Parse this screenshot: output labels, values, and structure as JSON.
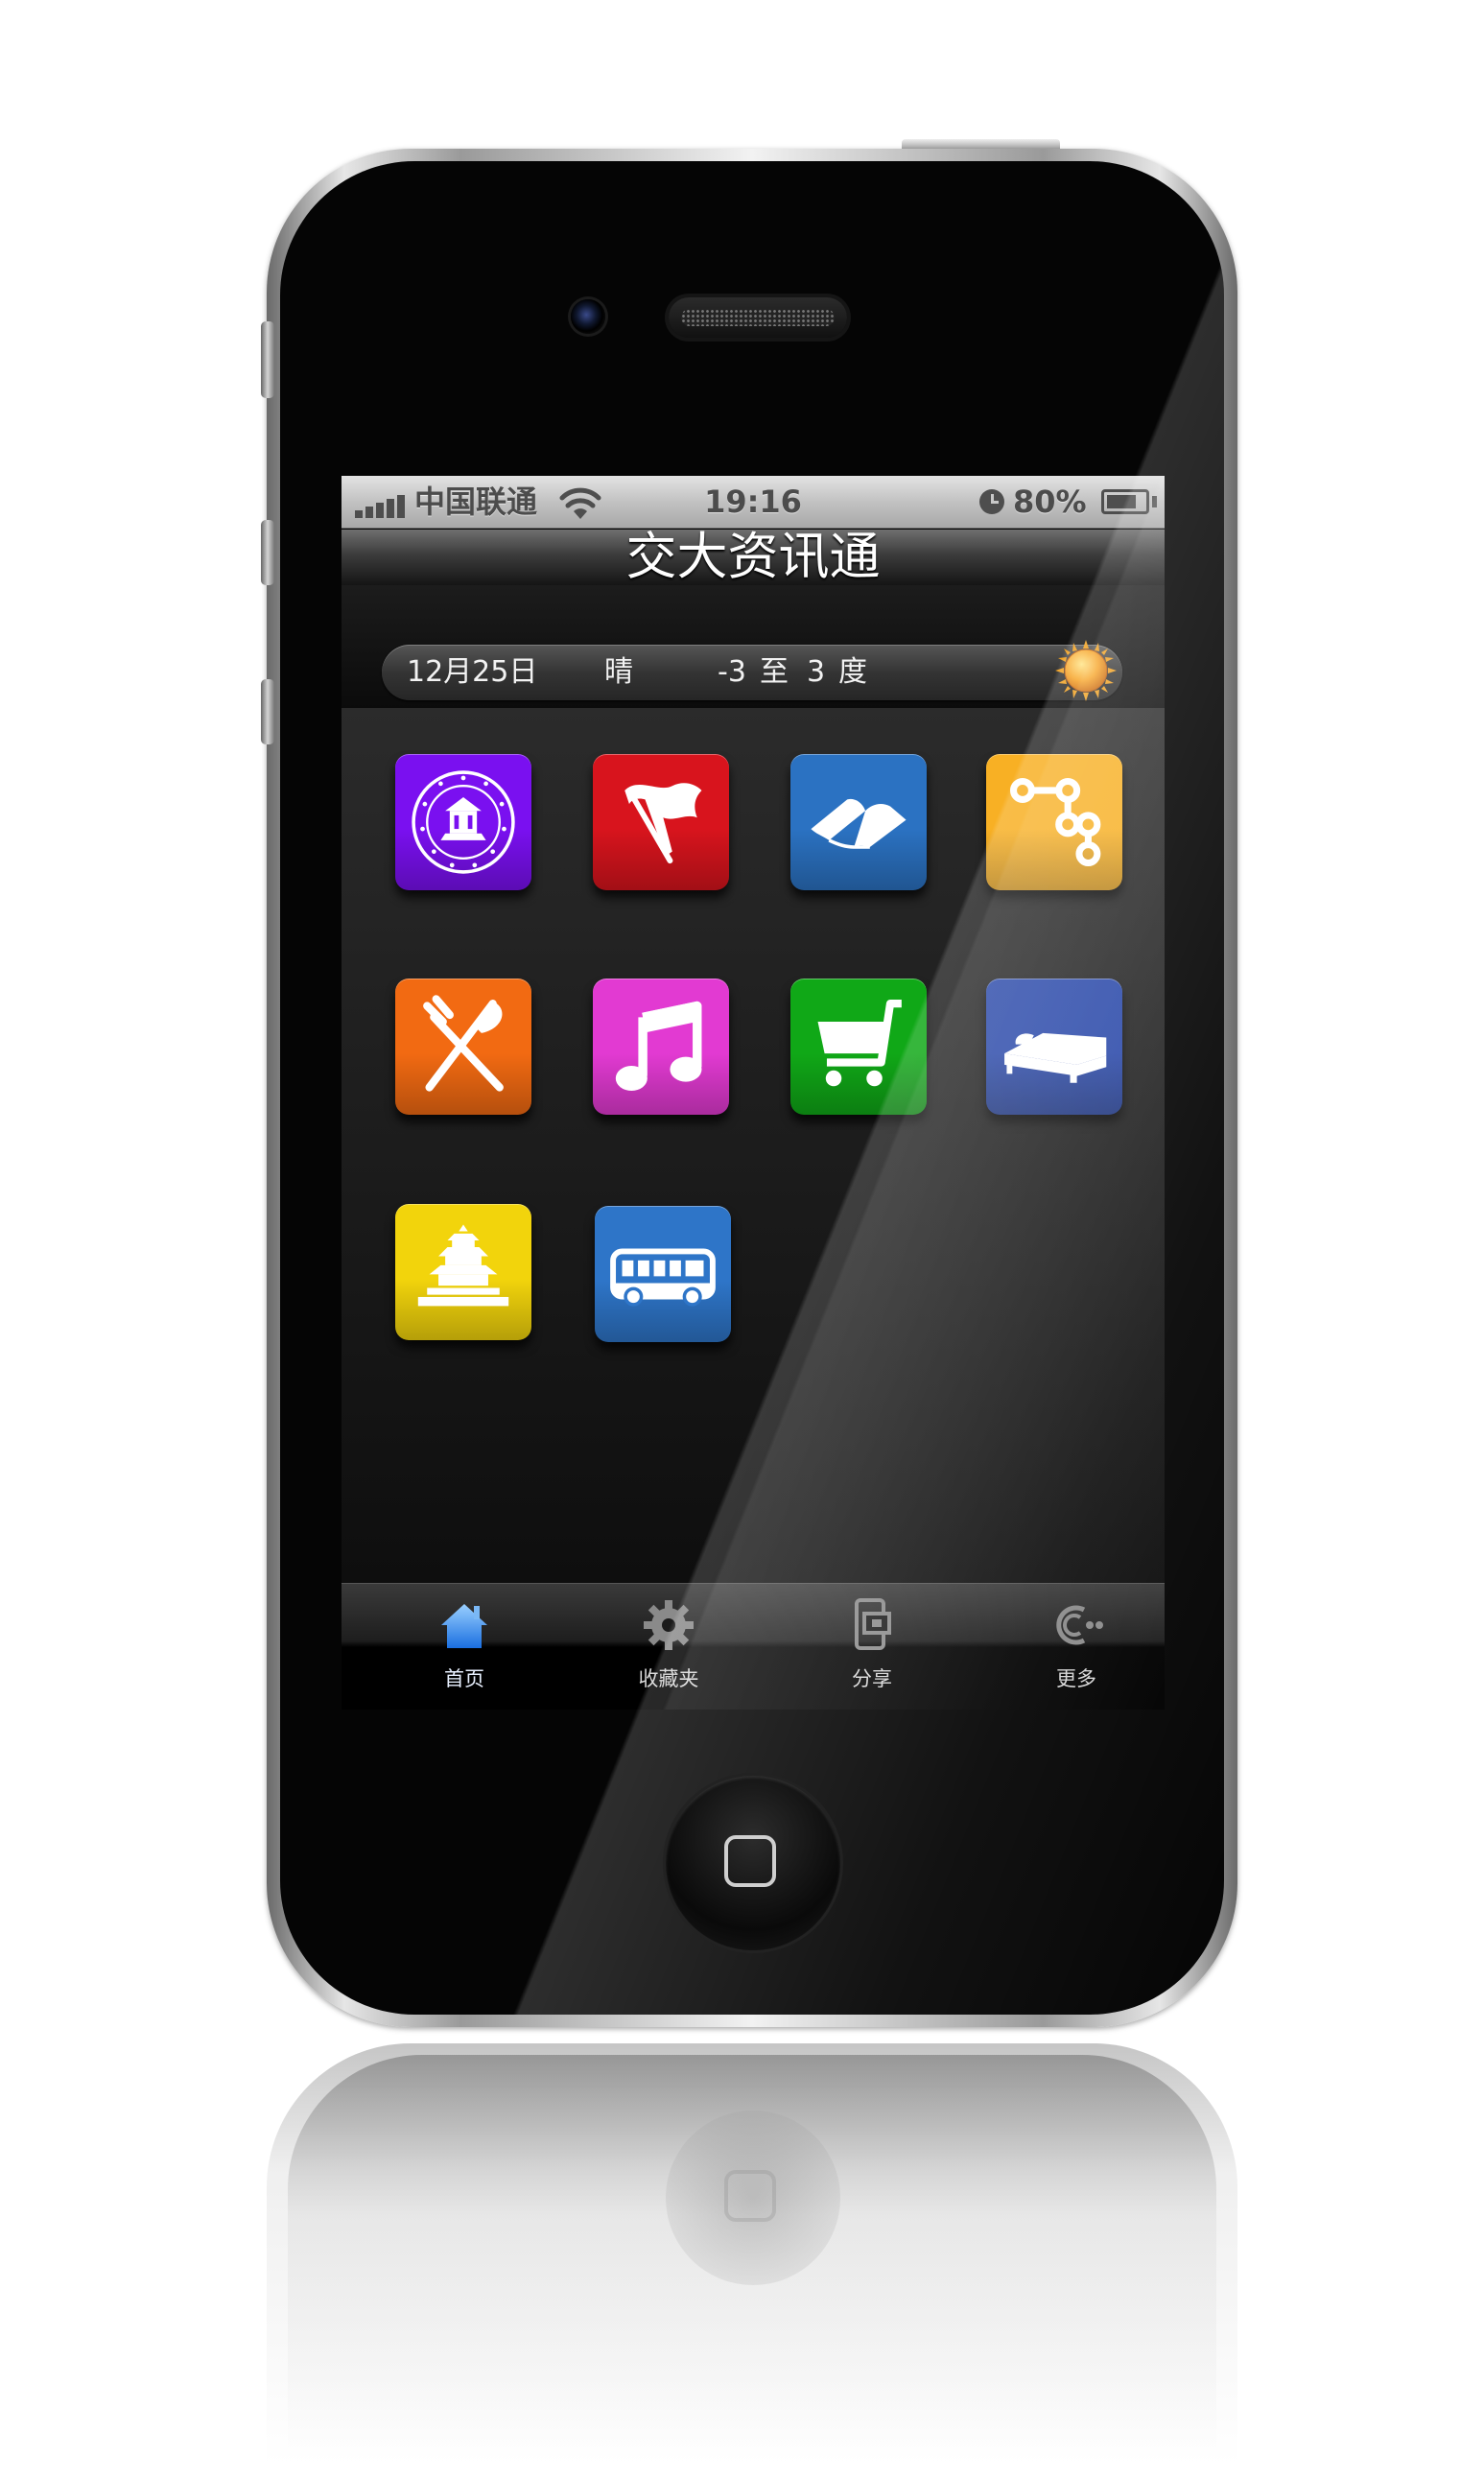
{
  "status_bar": {
    "carrier": "中国联通",
    "time": "19:16",
    "battery": "80%",
    "battery_level": 0.8
  },
  "nav": {
    "title": "交大资讯通"
  },
  "weather": {
    "date": "12月25日",
    "condition": "晴",
    "temp_low": "-3",
    "range_word": "至",
    "temp_high": "3",
    "unit": "度",
    "icon": "sun-icon"
  },
  "apps": [
    {
      "icon": "university-seal-icon",
      "color": "#7a10f0"
    },
    {
      "icon": "red-flag-icon",
      "color": "#d8141d"
    },
    {
      "icon": "open-book-icon",
      "color": "#2b72c2"
    },
    {
      "icon": "flow-chart-icon",
      "color": "#f8b024"
    },
    {
      "icon": "fork-knife-icon",
      "color": "#f26a12"
    },
    {
      "icon": "music-note-icon",
      "color": "#e23ad2"
    },
    {
      "icon": "shopping-cart-icon",
      "color": "#10a817"
    },
    {
      "icon": "bed-icon",
      "color": "#2746a8"
    },
    {
      "icon": "temple-icon",
      "color": "#f2d40c"
    },
    {
      "icon": "bus-icon",
      "color": "#2e75c8"
    }
  ],
  "tab_bar": {
    "items": [
      {
        "label": "首页",
        "icon": "home-icon",
        "active": true
      },
      {
        "label": "收藏夹",
        "icon": "gear-icon",
        "active": false
      },
      {
        "label": "分享",
        "icon": "share-icon",
        "active": false
      },
      {
        "label": "更多",
        "icon": "more-icon",
        "active": false
      }
    ]
  }
}
